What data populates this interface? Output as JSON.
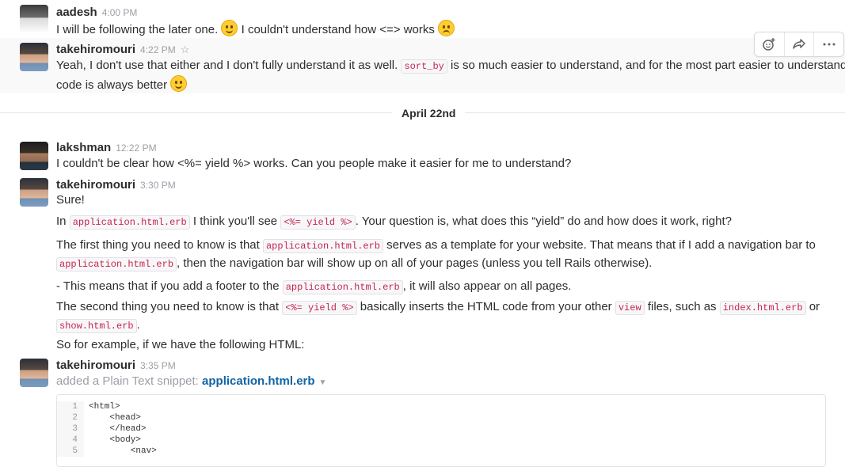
{
  "messages": {
    "m1": {
      "author": "aadesh",
      "time": "4:00 PM",
      "text_a": "I will be following the later one. ",
      "text_b": " I couldn't understand how <=> works "
    },
    "m2": {
      "author": "takehiromouri",
      "time": "4:22 PM",
      "text_a": "Yeah, I don't use that either and I don't fully understand it as well. ",
      "code": "sort_by",
      "text_b": " is so much easier to understand, and for the most part easier to understand",
      "text_c": "code is always better "
    },
    "m3": {
      "author": "lakshman",
      "time": "12:22 PM",
      "text": "I couldn't be clear how <%= yield %> works. Can you people make it easier for me to understand?"
    },
    "m4": {
      "author": "takehiromouri",
      "time": "3:30 PM",
      "p1": "Sure!",
      "p2_a": "In ",
      "p2_code1": "application.html.erb",
      "p2_b": " I think you'll see ",
      "p2_code2": "<%= yield %>",
      "p2_c": ". Your question is, what does this “yield” do and how does it work, right?",
      "p3_a": "The first thing you need to know is that ",
      "p3_code1": "application.html.erb",
      "p3_b": " serves as a template for your website. That means that if I add a navigation bar to",
      "p3_code2": "application.html.erb",
      "p3_c": ", then the navigation bar will show up on all of your pages (unless you tell Rails otherwise).",
      "p4_a": "- This means that if you add a footer to the ",
      "p4_code": "application.html.erb",
      "p4_b": ", it will also appear on all pages.",
      "p5_a": "The second thing you need to know is that ",
      "p5_code1": "<%= yield %>",
      "p5_b": " basically inserts the HTML code from your other ",
      "p5_code2": "view",
      "p5_c": " files, such as ",
      "p5_code3": "index.html.erb",
      "p5_d": " or",
      "p5_code4": "show.html.erb",
      "p5_e": ".",
      "p6": "So for example, if we have the following HTML:"
    },
    "m5": {
      "author": "takehiromouri",
      "time": "3:35 PM",
      "added": "added a Plain Text snippet: ",
      "file": "application.html.erb",
      "lines": [
        {
          "n": "1",
          "c": "<html>"
        },
        {
          "n": "2",
          "c": "    <head>"
        },
        {
          "n": "3",
          "c": "    </head>"
        },
        {
          "n": "4",
          "c": "    <body>"
        },
        {
          "n": "5",
          "c": "        <nav>"
        }
      ]
    }
  },
  "day_divider": "April 22nd",
  "icons": {
    "reaction": "add-reaction-icon",
    "share": "share-icon",
    "more": "more-icon",
    "star": "star-icon"
  }
}
